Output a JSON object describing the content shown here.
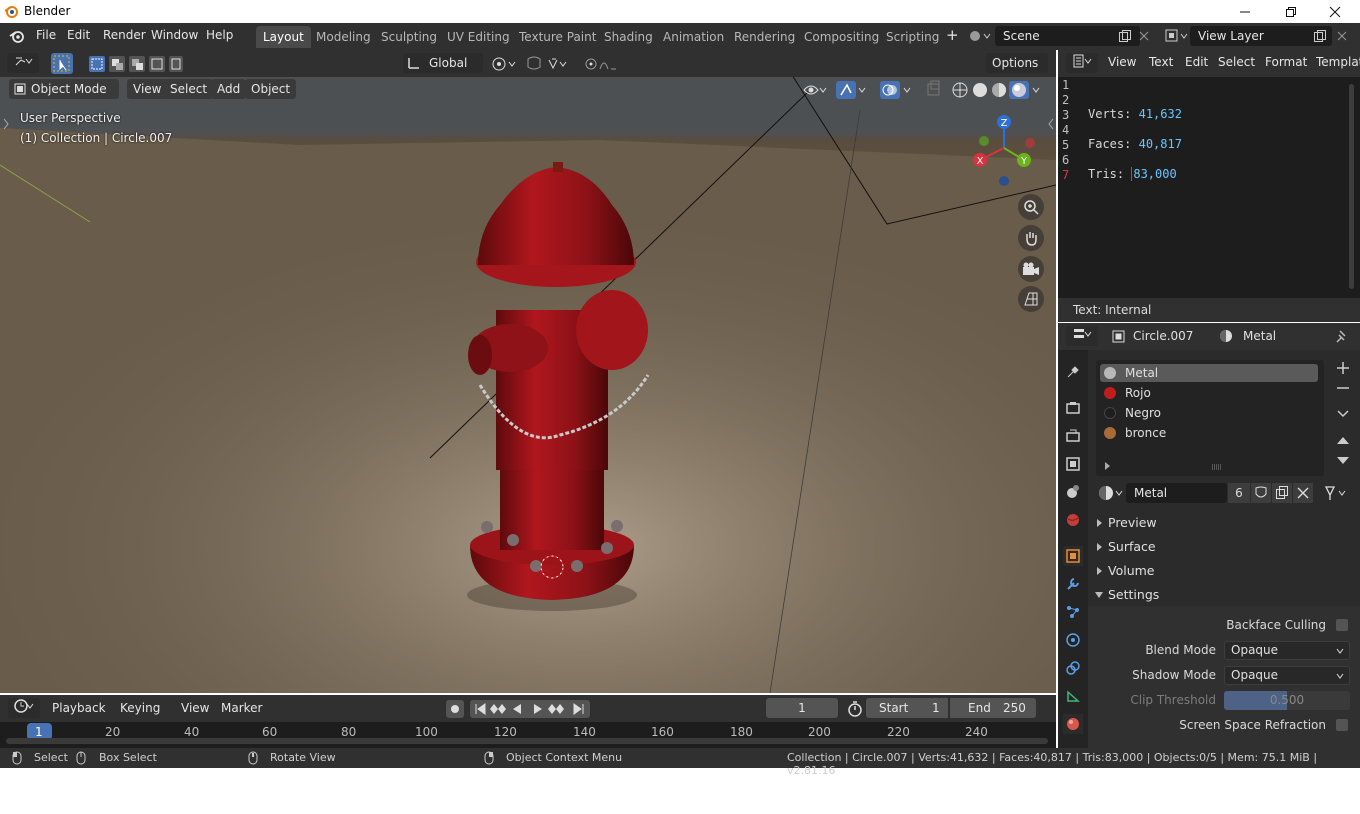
{
  "window": {
    "title": "Blender"
  },
  "menu": [
    "File",
    "Edit",
    "Render",
    "Window",
    "Help"
  ],
  "workspaces": [
    "Layout",
    "Modeling",
    "Sculpting",
    "UV Editing",
    "Texture Paint",
    "Shading",
    "Animation",
    "Rendering",
    "Compositing",
    "Scripting"
  ],
  "scene": {
    "name": "Scene",
    "view_layer": "View Layer"
  },
  "viewport": {
    "transform_orientation": "Global",
    "options_label": "Options",
    "mode": "Object Mode",
    "menus": [
      "View",
      "Select",
      "Add",
      "Object"
    ],
    "overlay_line1": "User Perspective",
    "overlay_line2": "(1) Collection | Circle.007",
    "gizmo_axes": {
      "x": "X",
      "y": "Y",
      "z": "Z"
    }
  },
  "text_editor": {
    "menus": [
      "View",
      "Text",
      "Edit",
      "Select",
      "Format",
      "Templates"
    ],
    "line_numbers": [
      "1",
      "2",
      "3",
      "4",
      "5",
      "6",
      "7"
    ],
    "lines": [
      {
        "label": "Verts:",
        "value": "41,632"
      },
      {
        "label": "Faces:",
        "value": "40,817"
      },
      {
        "label": "Tris:",
        "value": "83,000"
      }
    ],
    "footer": "Text: Internal"
  },
  "properties": {
    "object": "Circle.007",
    "material": "Metal",
    "slots": [
      {
        "name": "Metal",
        "color": "#b8b8b8"
      },
      {
        "name": "Rojo",
        "color": "#c21d1d"
      },
      {
        "name": "Negro",
        "color": "#1e1e1e"
      },
      {
        "name": "bronce",
        "color": "#a86a36"
      }
    ],
    "material_field": "Metal",
    "users": "6",
    "panels": [
      "Preview",
      "Surface",
      "Volume",
      "Settings"
    ],
    "settings": {
      "backface_culling": "Backface Culling",
      "blend_mode_label": "Blend Mode",
      "blend_mode": "Opaque",
      "shadow_mode_label": "Shadow Mode",
      "shadow_mode": "Opaque",
      "clip_threshold_label": "Clip Threshold",
      "clip_threshold": "0.500",
      "ssr_label": "Screen Space Refraction"
    }
  },
  "timeline": {
    "menus": [
      "Playback",
      "Keying",
      "View",
      "Marker"
    ],
    "current_frame": "1",
    "start_label": "Start",
    "start": "1",
    "end_label": "End",
    "end": "250",
    "ruler": [
      "1",
      "20",
      "40",
      "60",
      "80",
      "100",
      "120",
      "140",
      "160",
      "180",
      "200",
      "220",
      "240"
    ]
  },
  "statusbar": {
    "select": "Select",
    "box_select": "Box Select",
    "rotate_view": "Rotate View",
    "context_menu": "Object Context Menu",
    "stats": "Collection | Circle.007 | Verts:41,632 | Faces:40,817 | Tris:83,000 | Objects:0/5 | Mem: 75.1 MiB | v2.81.16"
  },
  "colors": {
    "accent": "#4772b3",
    "hydrant_red": "#a5161c",
    "header_bg": "#303030",
    "editor_bg": "#1d1d1d"
  }
}
